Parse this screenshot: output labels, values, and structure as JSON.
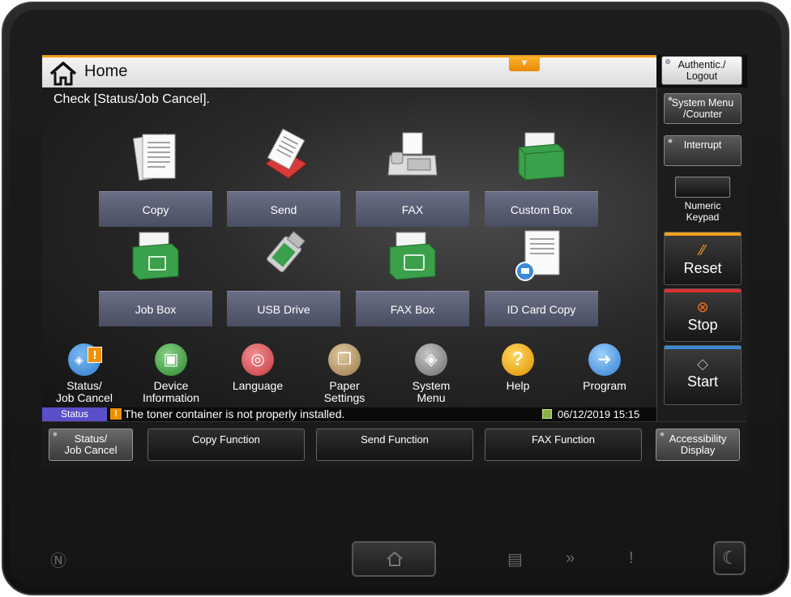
{
  "header": {
    "title": "Home",
    "notice_arrow": "▼"
  },
  "auth_button": {
    "label_line1": "Authentic./",
    "label_line2": "Logout"
  },
  "message": "Check [Status/Job Cancel].",
  "tiles": [
    {
      "label": "Copy",
      "icon": "copy-icon"
    },
    {
      "label": "Send",
      "icon": "send-icon"
    },
    {
      "label": "FAX",
      "icon": "fax-icon"
    },
    {
      "label": "Custom Box",
      "icon": "custom-box-icon"
    },
    {
      "label": "Job Box",
      "icon": "job-box-icon"
    },
    {
      "label": "USB Drive",
      "icon": "usb-drive-icon"
    },
    {
      "label": "FAX Box",
      "icon": "fax-box-icon"
    },
    {
      "label": "ID Card Copy",
      "icon": "id-card-copy-icon"
    }
  ],
  "shortcuts": [
    {
      "line1": "Status/",
      "line2": "Job Cancel",
      "icon": "status-icon",
      "color": "#2f7fd0"
    },
    {
      "line1": "Device",
      "line2": "Information",
      "icon": "device-info-icon",
      "color": "#3a9a3a"
    },
    {
      "line1": "Language",
      "line2": "",
      "icon": "language-icon",
      "color": "#d04850"
    },
    {
      "line1": "Paper",
      "line2": "Settings",
      "icon": "paper-settings-icon",
      "color": "#b08a5a"
    },
    {
      "line1": "System",
      "line2": "Menu",
      "icon": "system-menu-icon",
      "color": "#7a7a7a"
    },
    {
      "line1": "Help",
      "line2": "",
      "icon": "help-icon",
      "color": "#e8a000"
    },
    {
      "line1": "Program",
      "line2": "",
      "icon": "program-icon",
      "color": "#3a8ad8"
    }
  ],
  "status_bar": {
    "tag": "Status",
    "warning_glyph": "!",
    "message": "The toner container is not properly installed.",
    "datetime": "06/12/2019  15:15"
  },
  "right_panel": {
    "system_menu_line1": "System Menu",
    "system_menu_line2": "/Counter",
    "interrupt": "Interrupt",
    "numeric_line1": "Numeric",
    "numeric_line2": "Keypad",
    "reset": "Reset",
    "stop": "Stop",
    "start": "Start"
  },
  "function_bar": {
    "status_line1": "Status/",
    "status_line2": "Job Cancel",
    "copy_function": "Copy Function",
    "send_function": "Send Function",
    "fax_function": "FAX Function",
    "accessibility_line1": "Accessibility",
    "accessibility_line2": "Display"
  },
  "colors": {
    "accent_orange": "#f0a020",
    "status_purple": "#5a4fc8",
    "reset_stripe": "#f0a020",
    "stop_stripe": "#e03030",
    "start_stripe": "#3a8ad8"
  }
}
